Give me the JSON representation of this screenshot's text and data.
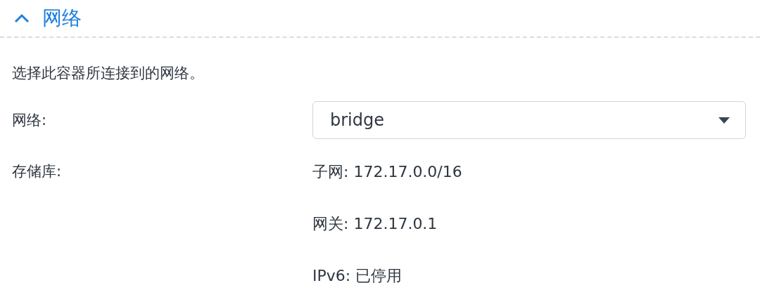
{
  "section": {
    "title": "网络",
    "expanded": true
  },
  "description": "选择此容器所连接到的网络。",
  "network": {
    "label": "网络:",
    "value": "bridge"
  },
  "storage": {
    "label": "存储库:",
    "details": [
      "子网: 172.17.0.0/16",
      "网关: 172.17.0.1",
      "IPv6: 已停用"
    ]
  }
}
